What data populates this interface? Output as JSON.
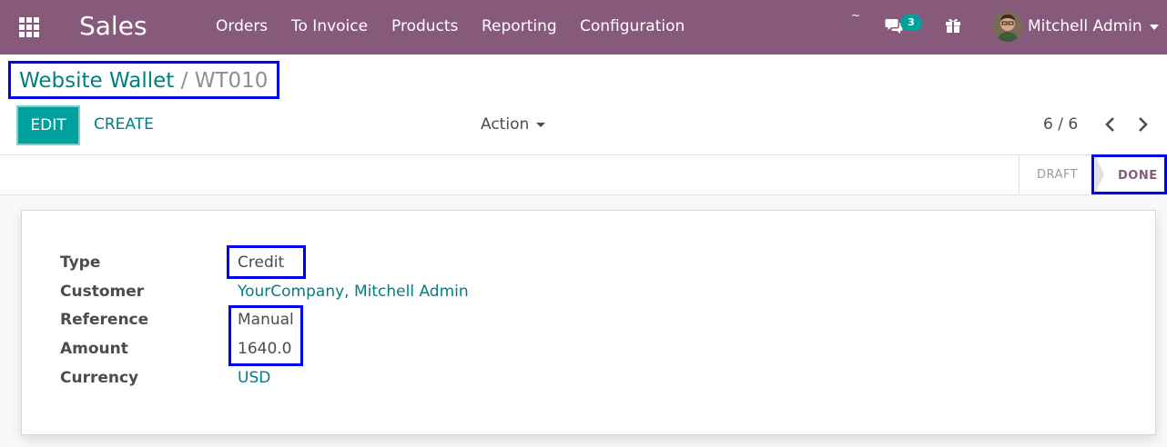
{
  "navbar": {
    "brand": "Sales",
    "menu": [
      "Orders",
      "To Invoice",
      "Products",
      "Reporting",
      "Configuration"
    ],
    "tilde": "~",
    "messages_count": "3",
    "user_name": "Mitchell Admin",
    "bg_color": "#875a7b"
  },
  "breadcrumb": {
    "parent": "Website Wallet",
    "separator": "/",
    "current": "WT010"
  },
  "toolbar": {
    "edit_label": "EDIT",
    "create_label": "CREATE",
    "action_label": "Action",
    "pager": "6 / 6"
  },
  "statusbar": {
    "draft_label": "DRAFT",
    "done_label": "DONE",
    "active": "DONE"
  },
  "form": {
    "fields": [
      {
        "label": "Type",
        "value": "Credit"
      },
      {
        "label": "Customer",
        "value": "YourCompany, Mitchell Admin"
      },
      {
        "label": "Reference",
        "value": "Manual"
      },
      {
        "label": "Amount",
        "value": "1640.0"
      },
      {
        "label": "Currency",
        "value": "USD"
      }
    ]
  },
  "colors": {
    "accent": "#00a09d",
    "link": "#017e84",
    "brand": "#875a7b",
    "highlight": "#0000ee"
  },
  "icons": [
    "apps-grid-icon",
    "chat-icon",
    "gift-icon",
    "avatar",
    "chevron-left-icon",
    "chevron-right-icon",
    "caret-down-icon"
  ]
}
